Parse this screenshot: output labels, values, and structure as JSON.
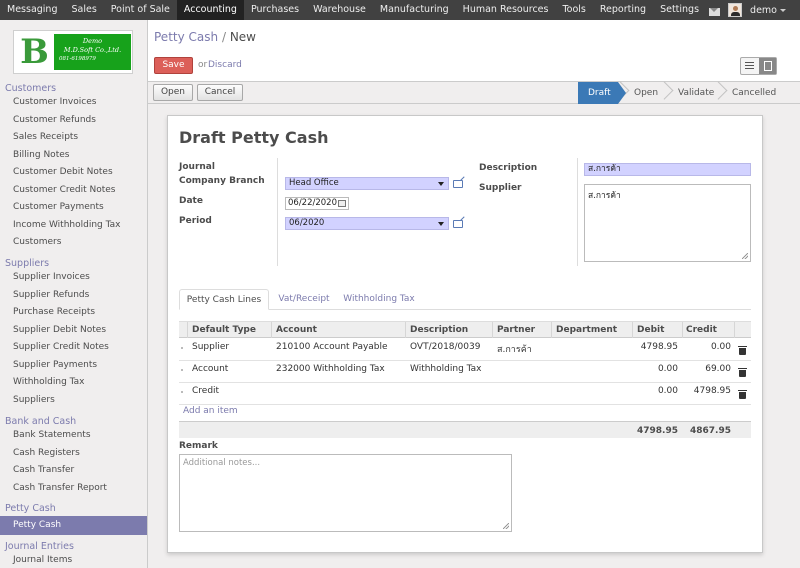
{
  "topbar": {
    "menu": [
      "Messaging",
      "Sales",
      "Point of Sale",
      "Accounting",
      "Purchases",
      "Warehouse",
      "Manufacturing",
      "Human Resources",
      "Tools",
      "Reporting",
      "Settings"
    ],
    "active_menu": "Accounting",
    "user": "demo"
  },
  "logo": {
    "letter": "B",
    "line1": "Demo",
    "line2": "M.D.Soft Co.,Ltd.",
    "line3": "081-6198979"
  },
  "sidebar": {
    "sections": [
      {
        "title": "Customers",
        "items": [
          "Customer Invoices",
          "Customer Refunds",
          "Sales Receipts",
          "Billing Notes",
          "Customer Debit Notes",
          "Customer Credit Notes",
          "Customer Payments",
          "Income Withholding Tax",
          "Customers"
        ]
      },
      {
        "title": "Suppliers",
        "items": [
          "Supplier Invoices",
          "Supplier Refunds",
          "Purchase Receipts",
          "Supplier Debit Notes",
          "Supplier Credit Notes",
          "Supplier Payments",
          "Withholding Tax",
          "Suppliers"
        ]
      },
      {
        "title": "Bank and Cash",
        "items": [
          "Bank Statements",
          "Cash Registers",
          "Cash Transfer",
          "Cash Transfer Report"
        ]
      },
      {
        "title": "Petty Cash",
        "items": [
          "Petty Cash"
        ]
      },
      {
        "title": "Journal Entries",
        "items": [
          "Journal Items"
        ]
      }
    ],
    "active_item": "Petty Cash"
  },
  "breadcrumb": {
    "parent": "Petty Cash",
    "sep": "/",
    "current": "New"
  },
  "actions": {
    "save": "Save",
    "or": "or",
    "discard": "Discard",
    "open": "Open",
    "cancel": "Cancel"
  },
  "stages": [
    "Draft",
    "Open",
    "Validate",
    "Cancelled"
  ],
  "form": {
    "title": "Draft Petty Cash",
    "labels": {
      "journal": "Journal",
      "company_branch": "Company Branch",
      "date": "Date",
      "period": "Period",
      "description": "Description",
      "supplier": "Supplier",
      "remark": "Remark"
    },
    "company_branch": "Head Office",
    "date": "06/22/2020",
    "period": "06/2020",
    "description": "ส.การค้า",
    "supplier": "ส.การค้า",
    "remark_placeholder": "Additional notes..."
  },
  "tabs": [
    "Petty Cash Lines",
    "Vat/Receipt",
    "Withholding Tax"
  ],
  "table": {
    "headers": [
      "Default Type",
      "Account",
      "Description",
      "Partner",
      "Department",
      "Debit",
      "Credit"
    ],
    "rows": [
      {
        "type": "Supplier",
        "account": "210100 Account Payable",
        "description": "OVT/2018/0039",
        "partner": "ส.การค้า",
        "department": "",
        "debit": "4798.95",
        "credit": "0.00"
      },
      {
        "type": "Account",
        "account": "232000 Withholding Tax",
        "description": "Withholding Tax",
        "partner": "",
        "department": "",
        "debit": "0.00",
        "credit": "69.00"
      },
      {
        "type": "Credit",
        "account": "",
        "description": "",
        "partner": "",
        "department": "",
        "debit": "0.00",
        "credit": "4798.95"
      }
    ],
    "add_item": "Add an item",
    "total_debit": "4798.95",
    "total_credit": "4867.95"
  }
}
